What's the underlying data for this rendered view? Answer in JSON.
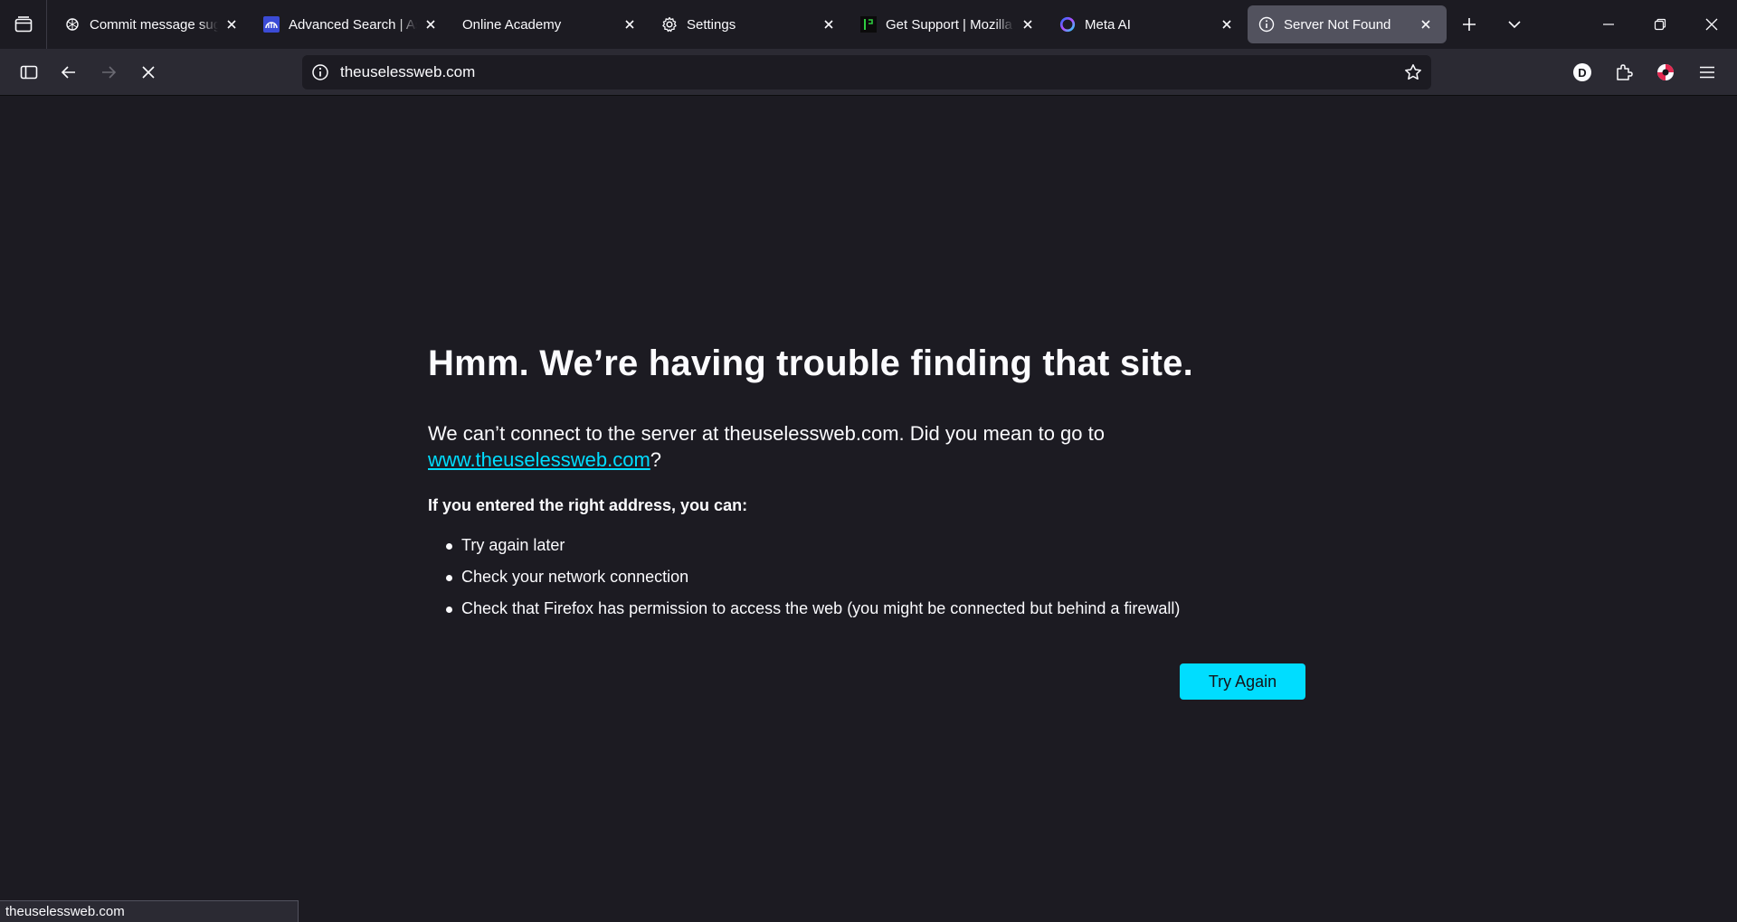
{
  "tabs": [
    {
      "title": "Commit message suggestion",
      "icon": "openai-icon",
      "active": false
    },
    {
      "title": "Advanced Search | Assembly",
      "icon": "advanced-search-icon",
      "active": false
    },
    {
      "title": "Online Academy",
      "icon": "",
      "active": false
    },
    {
      "title": "Settings",
      "icon": "gear-icon",
      "active": false
    },
    {
      "title": "Get Support | Mozilla Support",
      "icon": "mozilla-support-icon",
      "active": false
    },
    {
      "title": "Meta AI",
      "icon": "meta-ai-icon",
      "active": false
    },
    {
      "title": "Server Not Found",
      "icon": "info-icon",
      "active": true
    }
  ],
  "navbar": {
    "url": "theuselessweb.com",
    "profile_letter": "D"
  },
  "error_page": {
    "title": "Hmm. We’re having trouble finding that site.",
    "desc_prefix": "We can’t connect to the server at theuselessweb.com. Did you mean to go to ",
    "suggested_link": "www.theuselessweb.com",
    "desc_suffix": "?",
    "subheading": "If you entered the right address, you can:",
    "suggestions": [
      "Try again later",
      "Check your network connection",
      "Check that Firefox has permission to access the web (you might be connected but behind a firewall)"
    ],
    "try_again_label": "Try Again"
  },
  "status_bar": "theuselessweb.com",
  "colors": {
    "accent": "#00ddff",
    "background": "#1c1b22",
    "toolbar": "#2b2a33",
    "active_tab": "#52525e"
  }
}
